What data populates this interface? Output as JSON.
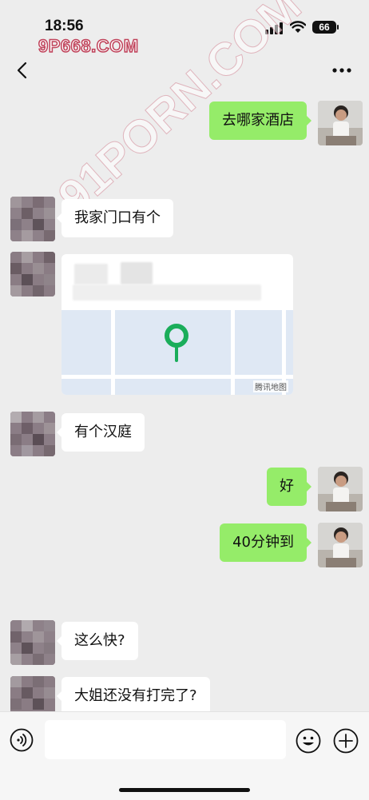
{
  "status_bar": {
    "time": "18:56",
    "battery": "66"
  },
  "watermark": {
    "top": "9P668.COM",
    "diagonal": "91PORN.COM"
  },
  "messages": [
    {
      "from": "me",
      "text": "去哪家酒店"
    },
    {
      "from": "other",
      "text": "我家门口有个"
    },
    {
      "from": "other",
      "type": "location",
      "map_source": "腾讯地图"
    },
    {
      "from": "other",
      "text": "有个汉庭"
    },
    {
      "from": "me",
      "text": "好"
    },
    {
      "from": "me",
      "text": "40分钟到"
    },
    {
      "from": "other",
      "text": "这么快?"
    },
    {
      "from": "other",
      "text": "大姐还没有打完了?"
    }
  ],
  "colors": {
    "my_bubble": "#95ec69",
    "other_bubble": "#ffffff",
    "background": "#ededed",
    "map_pin": "#1aad5a"
  },
  "icons": [
    "back-chevron-icon",
    "more-dots-icon",
    "voice-icon",
    "emoji-icon",
    "plus-icon",
    "map-pin-icon"
  ]
}
